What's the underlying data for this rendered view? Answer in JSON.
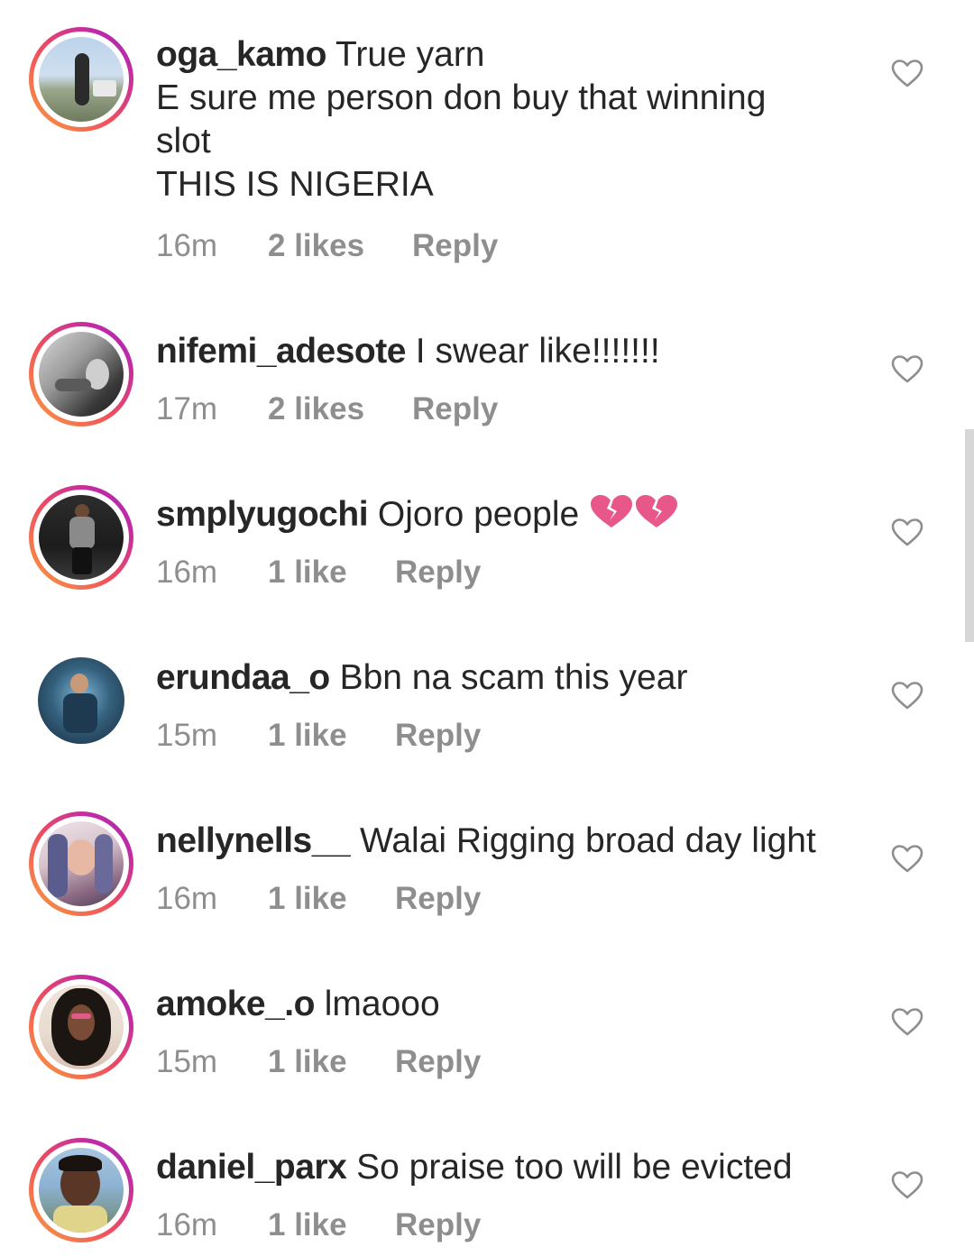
{
  "comments": [
    {
      "username": "oga_kamo",
      "text_lines": [
        "True yarn",
        "E sure me person don buy that winning",
        "slot",
        "THIS IS NIGERIA"
      ],
      "time": "16m",
      "likes": "2 likes",
      "reply": "Reply",
      "avatar": "user-photo",
      "has_story_ring": true
    },
    {
      "username": "nifemi_adesote",
      "text_lines": [
        "I swear like!!!!!!!"
      ],
      "time": "17m",
      "likes": "2 likes",
      "reply": "Reply",
      "avatar": "user-photo",
      "has_story_ring": true
    },
    {
      "username": "smplyugochi",
      "text_lines": [
        "Ojoro people"
      ],
      "emoji": [
        "broken-heart-icon",
        "broken-heart-icon"
      ],
      "time": "16m",
      "likes": "1 like",
      "reply": "Reply",
      "avatar": "user-photo",
      "has_story_ring": true
    },
    {
      "username": "erundaa_o",
      "text_lines": [
        "Bbn na scam this year"
      ],
      "time": "15m",
      "likes": "1 like",
      "reply": "Reply",
      "avatar": "user-photo",
      "has_story_ring": false
    },
    {
      "username": "nellynells__",
      "text_lines": [
        "Walai Rigging broad day light"
      ],
      "time": "16m",
      "likes": "1 like",
      "reply": "Reply",
      "avatar": "user-photo",
      "has_story_ring": true
    },
    {
      "username": "amoke_.o",
      "text_lines": [
        "lmaooo"
      ],
      "time": "15m",
      "likes": "1 like",
      "reply": "Reply",
      "avatar": "user-photo",
      "has_story_ring": true
    },
    {
      "username": "daniel_parx",
      "text_lines": [
        "So praise too will be evicted"
      ],
      "time": "16m",
      "likes": "1 like",
      "reply": "Reply",
      "avatar": "user-photo",
      "has_story_ring": true
    }
  ],
  "icons": {
    "like": "heart-outline-icon",
    "emoji": "broken-heart-icon"
  },
  "colors": {
    "text": "#262626",
    "meta": "#8e8e8e",
    "heart_outline": "#8e8e8e",
    "broken_heart": "#e8578a",
    "ring_start": "#f9a23c",
    "ring_end": "#c02aa6"
  }
}
